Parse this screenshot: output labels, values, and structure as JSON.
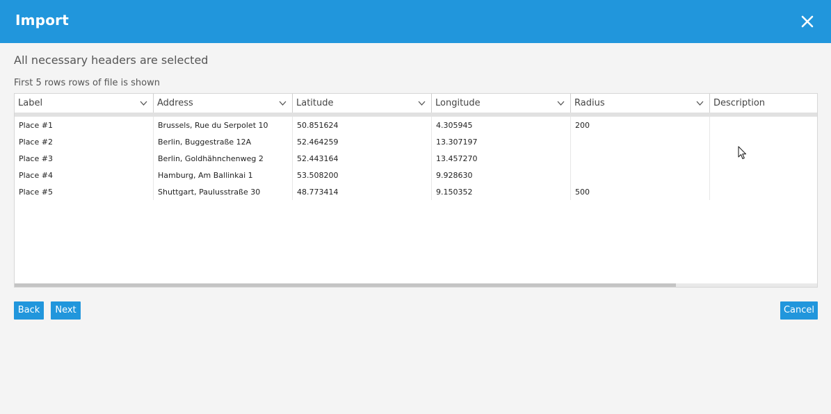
{
  "dialog": {
    "title": "Import",
    "status": "All necessary headers are selected",
    "subtitle": "First 5 rows rows of file is shown"
  },
  "table": {
    "columns": [
      "Label",
      "Address",
      "Latitude",
      "Longitude",
      "Radius",
      "Description"
    ],
    "rows": [
      [
        "Place #1",
        "Brussels, Rue du Serpolet 10",
        "50.851624",
        "4.305945",
        "200",
        ""
      ],
      [
        "Place #2",
        "Berlin, Buggestraße 12A",
        "52.464259",
        "13.307197",
        "",
        ""
      ],
      [
        "Place #3",
        "Berlin, Goldhähnchenweg 2",
        "52.443164",
        "13.457270",
        "",
        ""
      ],
      [
        "Place #4",
        "Hamburg, Am Ballinkai 1",
        "53.508200",
        "9.928630",
        "",
        ""
      ],
      [
        "Place #5",
        "Shuttgart, Paulusstraße 30",
        "48.773414",
        "9.150352",
        "500",
        ""
      ]
    ]
  },
  "buttons": {
    "back": "Back",
    "next": "Next",
    "cancel": "Cancel"
  },
  "icons": {
    "close": "close-icon",
    "column_dropdown": "chevron-down-icon",
    "cursor": "mouse-pointer-icon"
  },
  "colors": {
    "accent": "#2196dc",
    "background": "#f4f4f4"
  }
}
